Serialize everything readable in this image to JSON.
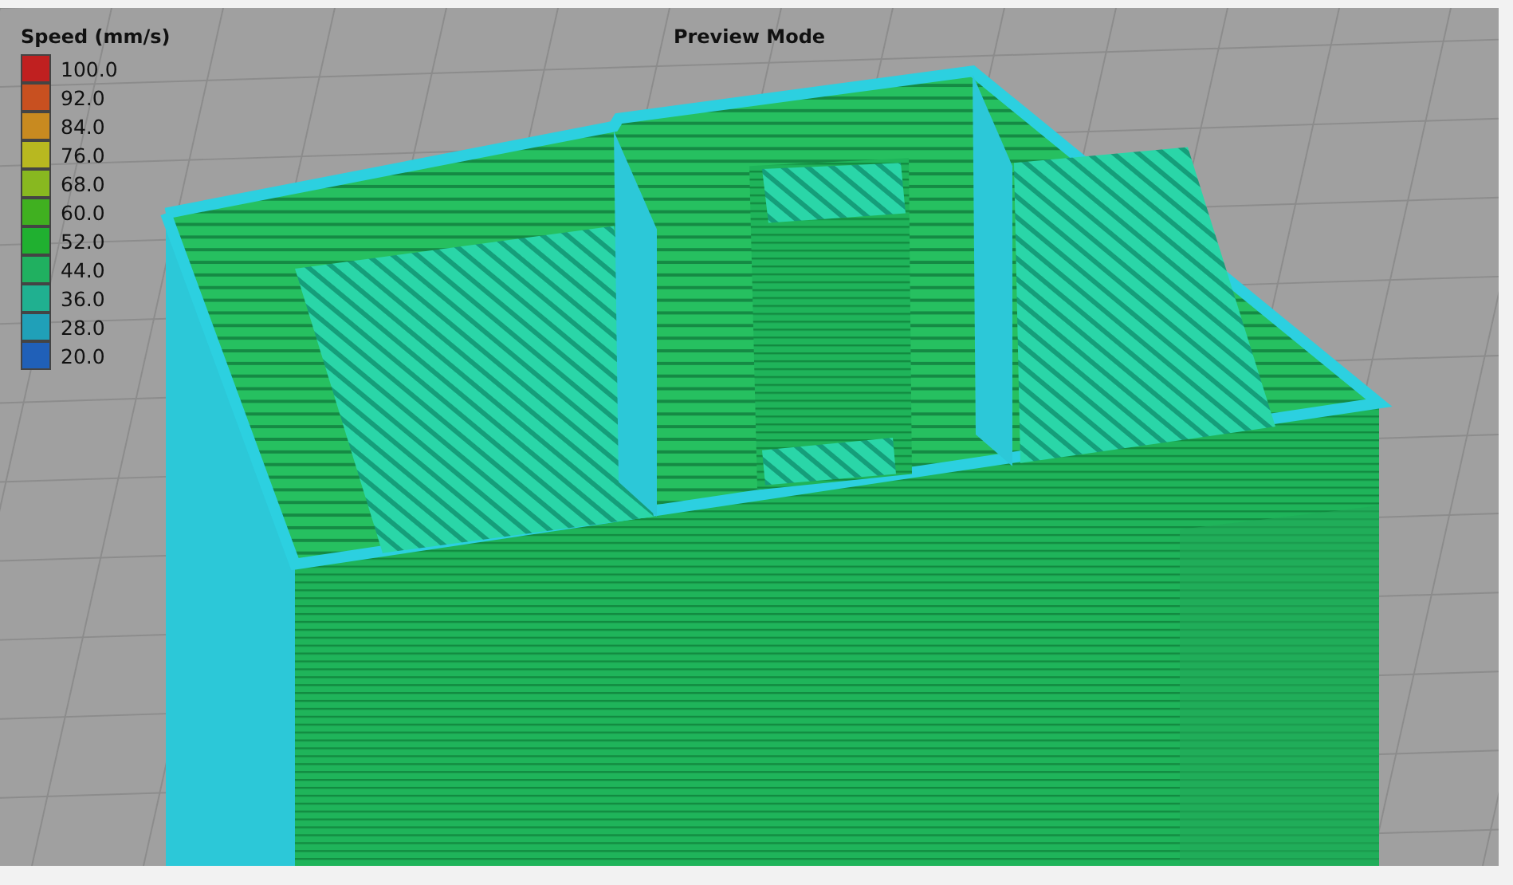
{
  "viewport": {
    "title": "Preview Mode"
  },
  "legend": {
    "title": "Speed (mm/s)",
    "items": [
      {
        "label": "100.0",
        "color": "#c02020"
      },
      {
        "label": "92.0",
        "color": "#c85020"
      },
      {
        "label": "84.0",
        "color": "#c88a20"
      },
      {
        "label": "76.0",
        "color": "#b8b820"
      },
      {
        "label": "68.0",
        "color": "#88b820"
      },
      {
        "label": "60.0",
        "color": "#40b020"
      },
      {
        "label": "52.0",
        "color": "#20b030"
      },
      {
        "label": "44.0",
        "color": "#20b060"
      },
      {
        "label": "36.0",
        "color": "#20b090"
      },
      {
        "label": "28.0",
        "color": "#20a0b8"
      },
      {
        "label": "20.0",
        "color": "#2060b8"
      }
    ]
  }
}
